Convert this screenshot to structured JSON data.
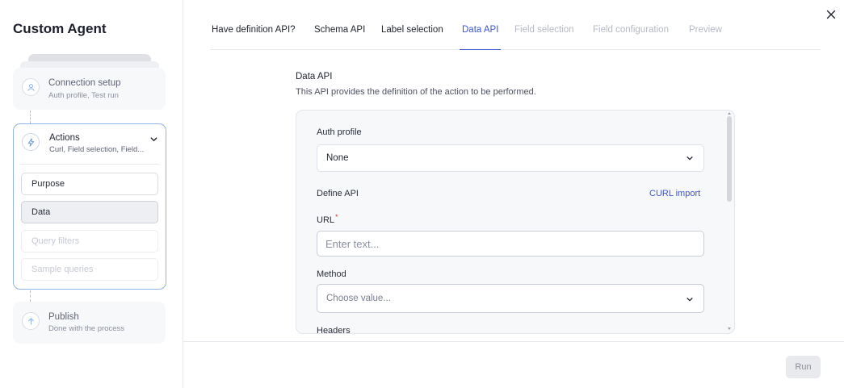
{
  "app": {
    "title": "Custom Agent"
  },
  "steps": {
    "connection": {
      "title": "Connection setup",
      "subtitle": "Auth profile, Test run"
    },
    "actions": {
      "title": "Actions",
      "subtitle": "Curl, Field selection, Field...",
      "subitems": [
        {
          "label": "Purpose",
          "state": "enabled"
        },
        {
          "label": "Data",
          "state": "selected"
        },
        {
          "label": "Query filters",
          "state": "disabled"
        },
        {
          "label": "Sample queries",
          "state": "disabled"
        }
      ]
    },
    "publish": {
      "title": "Publish",
      "subtitle": "Done with the process"
    }
  },
  "tabs": [
    {
      "label": "Have definition API?",
      "state": "normal"
    },
    {
      "label": "Schema API",
      "state": "normal"
    },
    {
      "label": "Label selection",
      "state": "normal"
    },
    {
      "label": "Data API",
      "state": "active"
    },
    {
      "label": "Field selection",
      "state": "disabled"
    },
    {
      "label": "Field configuration",
      "state": "disabled"
    },
    {
      "label": "Preview",
      "state": "disabled"
    }
  ],
  "section": {
    "title": "Data API",
    "description": "This API provides the definition of the action to be performed."
  },
  "form": {
    "auth_profile_label": "Auth profile",
    "auth_profile_value": "None",
    "define_api_label": "Define API",
    "curl_import_label": "CURL import",
    "url_label": "URL",
    "url_required_mark": "*",
    "url_placeholder": "Enter text...",
    "url_value": "",
    "method_label": "Method",
    "method_placeholder": "Choose value...",
    "headers_label": "Headers"
  },
  "footer": {
    "run_label": "Run"
  },
  "colors": {
    "accent": "#3a56d4",
    "active_border": "#8fb4ea",
    "required": "#d23b3b",
    "disabled_text": "#b5b9c4"
  }
}
